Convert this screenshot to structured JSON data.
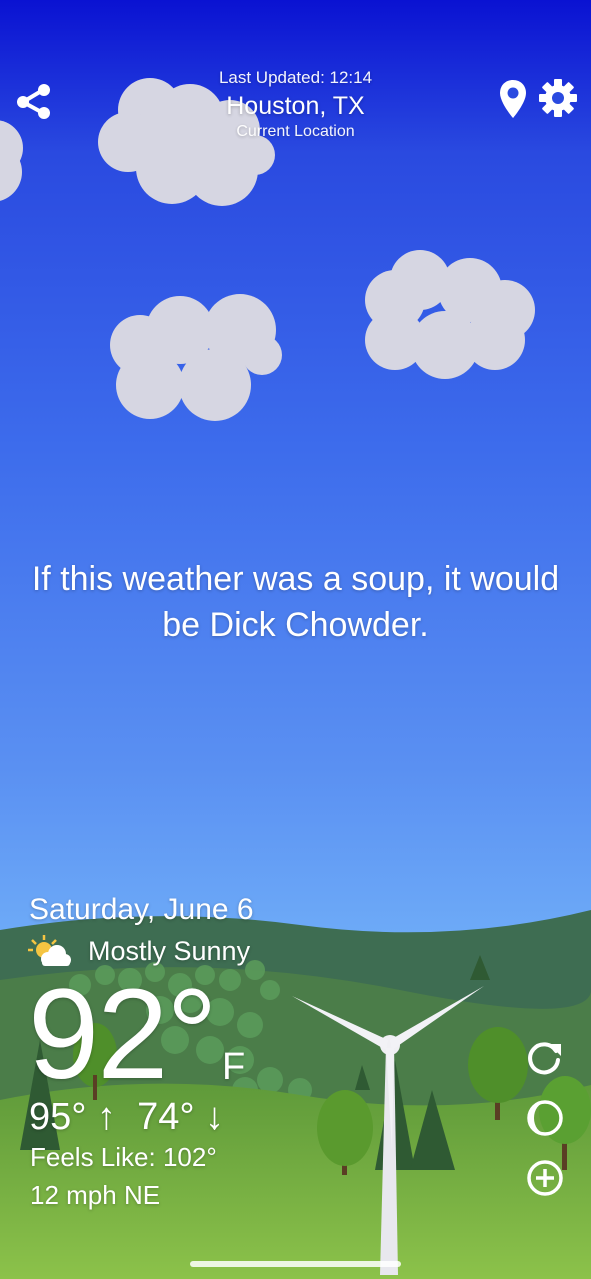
{
  "header": {
    "last_updated": "Last Updated: 12:14",
    "city": "Houston, TX",
    "location_subtitle": "Current Location"
  },
  "quote": "If this weather was a soup, it would be Dick Chowder.",
  "forecast": {
    "date": "Saturday, June 6",
    "condition": "Mostly Sunny",
    "condition_icon": "sun-cloud-icon",
    "temperature": "92°",
    "unit": "F",
    "high_low": "95° ↑  74° ↓",
    "feels_like": "Feels Like: 102°",
    "wind": "12 mph NE"
  },
  "icons": {
    "share": "share-icon",
    "location": "location-pin-icon",
    "settings": "gear-icon",
    "refresh": "refresh-icon",
    "theme": "moon-icon",
    "add": "plus-circle-icon"
  },
  "colors": {
    "sky_top": "#0a12d2",
    "sky_bottom": "#7ab8fa",
    "hills_far": "#3b6a54",
    "grass": "#6aa83a",
    "cloud": "#d3d3e0"
  }
}
